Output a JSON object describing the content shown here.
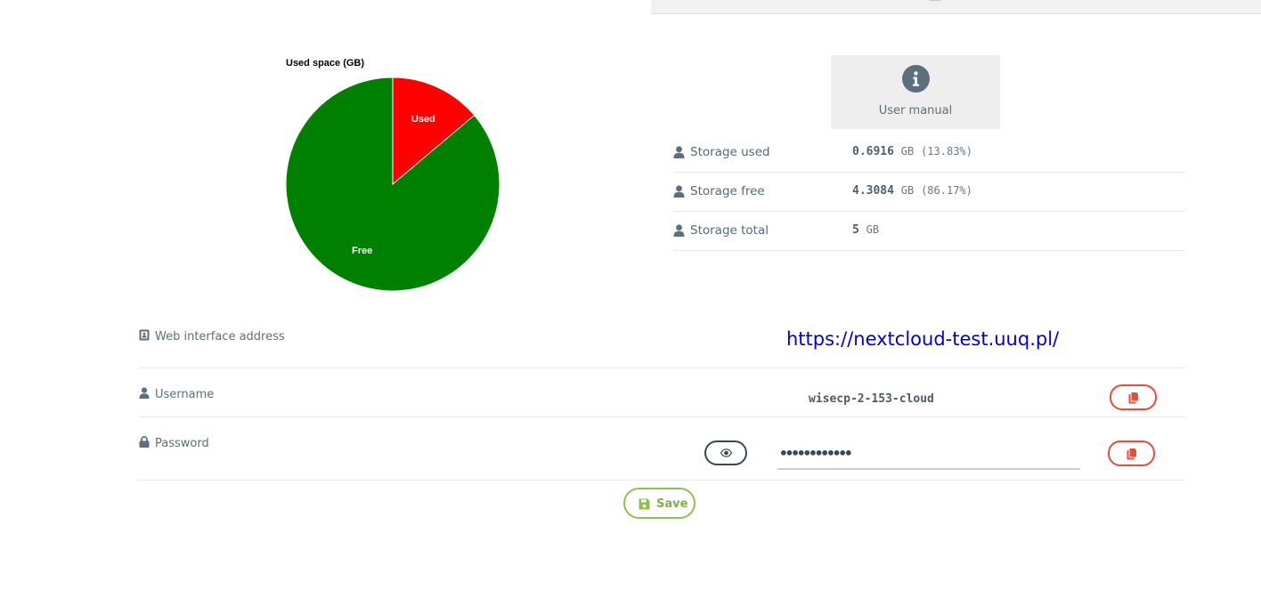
{
  "chart_data": {
    "type": "pie",
    "title": "Used space (GB)",
    "categories": [
      "Used",
      "Free"
    ],
    "values": [
      0.6916,
      4.3084
    ],
    "colors": [
      "#ff0000",
      "#008000"
    ]
  },
  "user_manual": {
    "label": "User manual",
    "icon": "info-icon"
  },
  "storage": {
    "rows": [
      {
        "label": "Storage used",
        "value": "0.6916",
        "unit": "GB",
        "percent": "(13.83%)"
      },
      {
        "label": "Storage free",
        "value": "4.3084",
        "unit": "GB",
        "percent": "(86.17%)"
      },
      {
        "label": "Storage total",
        "value": "5",
        "unit": "GB",
        "percent": ""
      }
    ]
  },
  "credentials": {
    "web_label": "Web interface address",
    "web_url": "https://nextcloud-test.uuq.pl/",
    "username_label": "Username",
    "username_value": "wisecp-2-153-cloud",
    "password_label": "Password",
    "password_value": "••••••••••••"
  },
  "actions": {
    "save_label": "Save"
  },
  "colors": {
    "danger": "#e74c3c",
    "success": "#8bc34a",
    "dark": "#34495e",
    "link": "#0000d8"
  }
}
